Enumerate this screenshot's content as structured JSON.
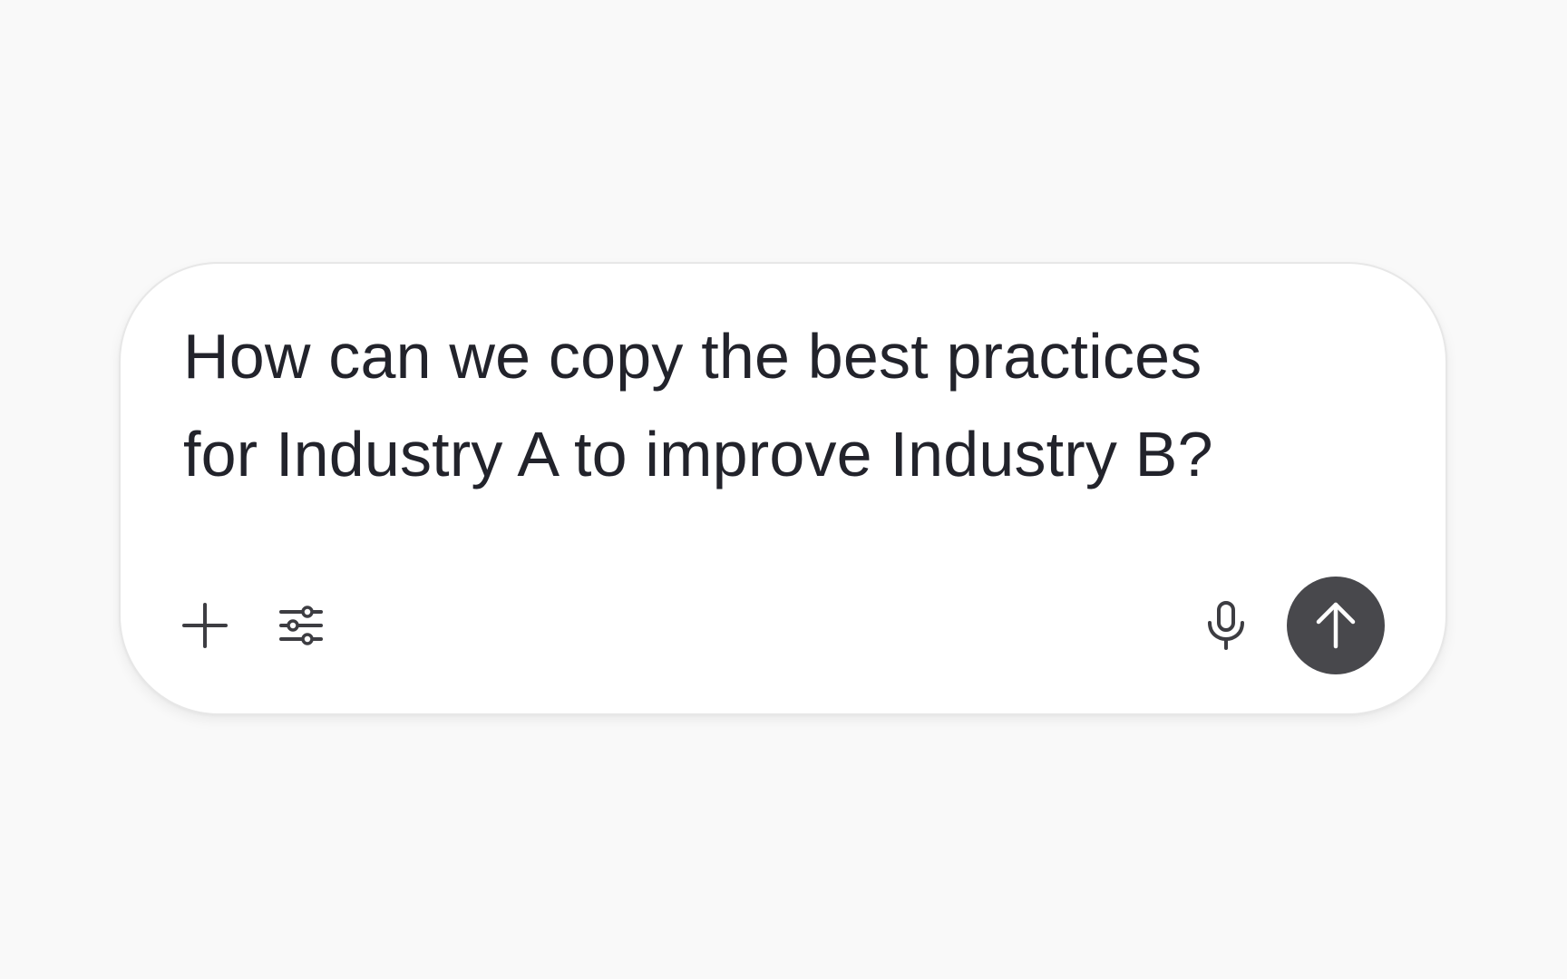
{
  "composer": {
    "prompt_text": "How can we copy the best practices\nfor Industry A to improve Industry B?",
    "add_icon": "plus-icon",
    "tools_icon": "sliders-icon",
    "mic_icon": "microphone-icon",
    "send_icon": "arrow-up-icon"
  },
  "colors": {
    "page_background": "#f9f9f9",
    "composer_background": "#ffffff",
    "text": "#22232b",
    "icon": "#3d3d42",
    "send_button": "#48484c",
    "send_icon": "#ffffff"
  }
}
